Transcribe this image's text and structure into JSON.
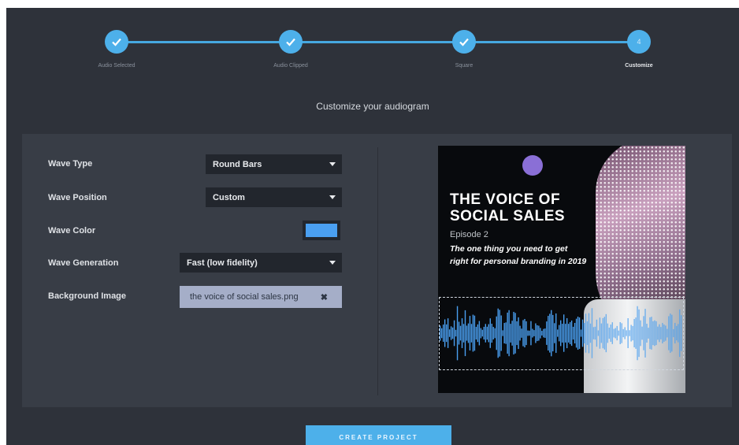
{
  "stepper": {
    "steps": [
      {
        "label": "Audio Selected",
        "state": "done"
      },
      {
        "label": "Audio Clipped",
        "state": "done"
      },
      {
        "label": "Square",
        "state": "done"
      },
      {
        "label": "Customize",
        "state": "active",
        "number": "4"
      }
    ]
  },
  "heading": "Customize your audiogram",
  "form": {
    "wave_type": {
      "label": "Wave Type",
      "value": "Round Bars"
    },
    "wave_position": {
      "label": "Wave Position",
      "value": "Custom"
    },
    "wave_color": {
      "label": "Wave Color",
      "value": "#4a9ff0"
    },
    "wave_generation": {
      "label": "Wave Generation",
      "value": "Fast (low fidelity)"
    },
    "background_image": {
      "label": "Background Image",
      "value": "the voice of social sales.png"
    }
  },
  "preview": {
    "title_line1": "THE VOICE OF",
    "title_line2": "SOCIAL SALES",
    "episode": "Episode 2",
    "subtitle": "The one thing you need to get right for personal branding in 2019"
  },
  "actions": {
    "create_label": "CREATE PROJECT"
  },
  "colors": {
    "accent": "#4db0ea",
    "panel": "#383d46",
    "background": "#2e323a"
  }
}
